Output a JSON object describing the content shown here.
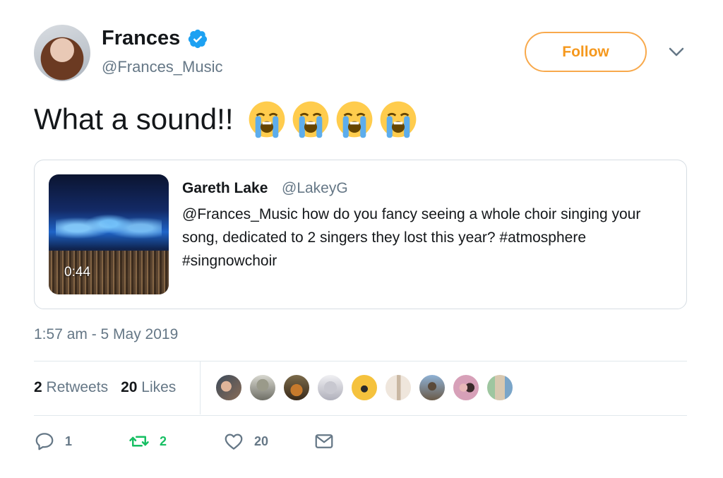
{
  "author": {
    "name": "Frances",
    "handle": "@Frances_Music",
    "verified_icon": "verified-badge-icon"
  },
  "header": {
    "follow_label": "Follow",
    "menu_icon": "chevron-down-icon"
  },
  "tweet": {
    "text": "What a sound!!",
    "emoji": [
      "😭",
      "😭",
      "😭",
      "😭"
    ]
  },
  "quote": {
    "name": "Gareth Lake",
    "handle": "@LakeyG",
    "text": "@Frances_Music how do you fancy seeing a whole choir singing your song, dedicated to 2 singers they lost this year? #atmosphere #singnowchoir",
    "video_duration": "0:44"
  },
  "meta": {
    "timestamp": "1:57 am - 5 May 2019"
  },
  "stats": {
    "retweets_count": "2",
    "retweets_label": "Retweets",
    "likes_count": "20",
    "likes_label": "Likes"
  },
  "actions": {
    "reply_count": "1",
    "retweet_count": "2",
    "like_count": "20"
  },
  "colors": {
    "accent": "#f5981d",
    "verified": "#1da1f2",
    "retweet_green": "#17bf63",
    "muted": "#657786",
    "text": "#14171a"
  }
}
